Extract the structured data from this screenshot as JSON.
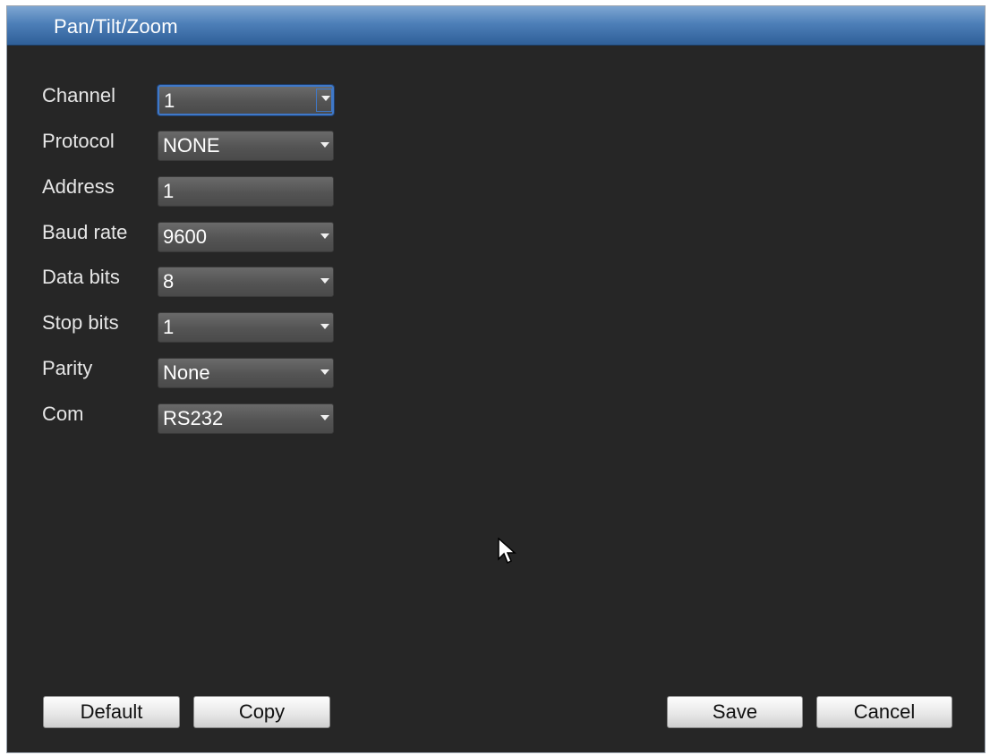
{
  "window": {
    "title": "Pan/Tilt/Zoom"
  },
  "form": {
    "channel": {
      "label": "Channel",
      "value": "1"
    },
    "protocol": {
      "label": "Protocol",
      "value": "NONE"
    },
    "address": {
      "label": "Address",
      "value": "1"
    },
    "baud_rate": {
      "label": "Baud rate",
      "value": "9600"
    },
    "data_bits": {
      "label": "Data bits",
      "value": "8"
    },
    "stop_bits": {
      "label": "Stop bits",
      "value": "1"
    },
    "parity": {
      "label": "Parity",
      "value": "None"
    },
    "com": {
      "label": "Com",
      "value": "RS232"
    }
  },
  "buttons": {
    "default": "Default",
    "copy": "Copy",
    "save": "Save",
    "cancel": "Cancel"
  },
  "colors": {
    "titlebar_accent": "#4d7fb8",
    "panel_background": "#262626",
    "focus_border": "#3f78c8"
  },
  "icons": {
    "dropdown": "chevron-down-icon",
    "pointer": "mouse-pointer-icon"
  }
}
